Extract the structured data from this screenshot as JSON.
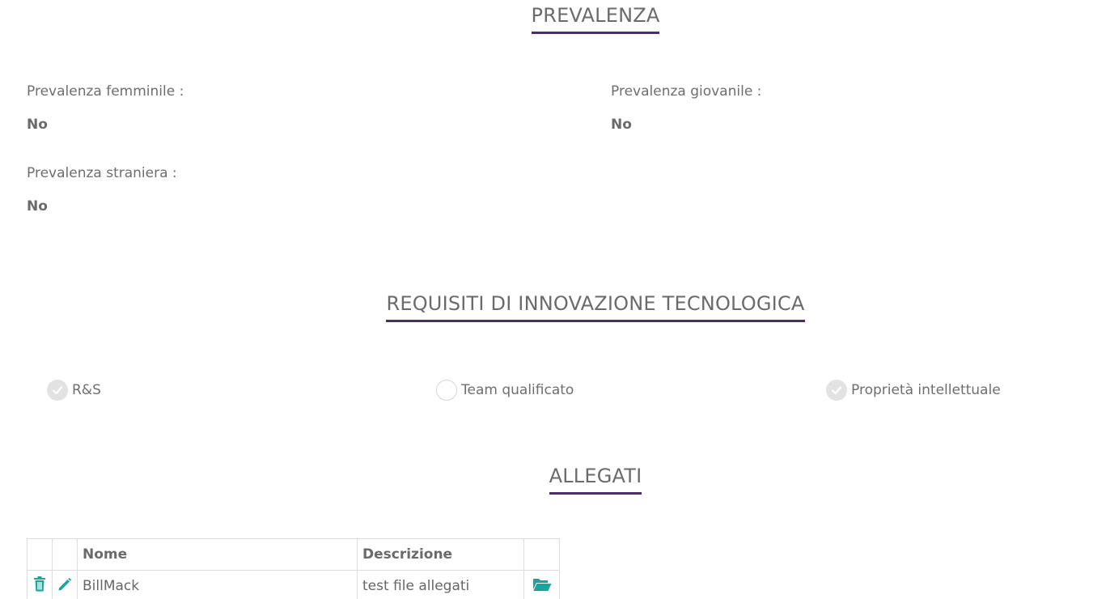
{
  "prevalenza": {
    "title": "PREVALENZA",
    "fields": [
      {
        "label": "Prevalenza femminile :",
        "value": "No"
      },
      {
        "label": "Prevalenza giovanile :",
        "value": "No"
      },
      {
        "label": "Prevalenza straniera :",
        "value": "No"
      }
    ]
  },
  "requisiti": {
    "title": "REQUISITI DI INNOVAZIONE TECNOLOGICA",
    "items": [
      {
        "label": "R&S",
        "checked": true
      },
      {
        "label": "Team qualificato",
        "checked": false
      },
      {
        "label": "Proprietà intellettuale",
        "checked": true
      }
    ]
  },
  "allegati": {
    "title": "ALLEGATI",
    "columns": {
      "nome": "Nome",
      "descrizione": "Descrizione"
    },
    "rows": [
      {
        "nome": "BillMack",
        "descrizione": "test file allegati"
      }
    ],
    "icons": {
      "delete": "trash-icon",
      "edit": "pencil-icon",
      "open": "folder-open-icon"
    }
  },
  "colors": {
    "accent_underline": "#4a2d6b",
    "icon_teal": "#1ba39c",
    "check_on": "#e2e2e2"
  }
}
